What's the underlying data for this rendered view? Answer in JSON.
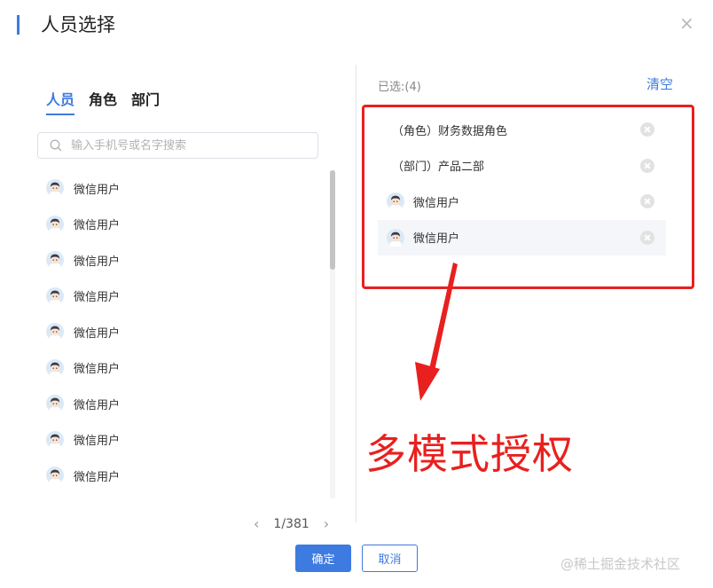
{
  "dialog": {
    "title": "人员选择",
    "close_symbol": "×"
  },
  "tabs": [
    {
      "label": "人员",
      "active": true
    },
    {
      "label": "角色",
      "active": false
    },
    {
      "label": "部门",
      "active": false
    }
  ],
  "search": {
    "placeholder": "输入手机号或名字搜索",
    "value": ""
  },
  "user_list": [
    {
      "name": "微信用户",
      "icon": "user-avatar"
    },
    {
      "name": "微信用户",
      "icon": "user-avatar"
    },
    {
      "name": "微信用户",
      "icon": "user-avatar"
    },
    {
      "name": "微信用户",
      "icon": "user-avatar"
    },
    {
      "name": "微信用户",
      "icon": "user-avatar"
    },
    {
      "name": "微信用户",
      "icon": "user-avatar"
    },
    {
      "name": "微信用户",
      "icon": "user-avatar"
    },
    {
      "name": "微信用户",
      "icon": "user-avatar"
    },
    {
      "name": "微信用户",
      "icon": "user-avatar"
    }
  ],
  "pagination": {
    "prev": "‹",
    "page_text": "1/381",
    "next": "›"
  },
  "selected": {
    "header": "已选:(4)",
    "clear_label": "清空",
    "items": [
      {
        "label": "（角色）财务数据角色",
        "type": "role"
      },
      {
        "label": "（部门）产品二部",
        "type": "department"
      },
      {
        "label": "微信用户",
        "type": "user"
      },
      {
        "label": "微信用户",
        "type": "user"
      }
    ]
  },
  "annotation": {
    "text": "多模式授权",
    "color": "#e8201f"
  },
  "footer": {
    "confirm_label": "确定",
    "cancel_label": "取消"
  },
  "watermark": "@稀土掘金技术社区",
  "colors": {
    "accent": "#3d7be0",
    "annotation_red": "#e8201f"
  }
}
